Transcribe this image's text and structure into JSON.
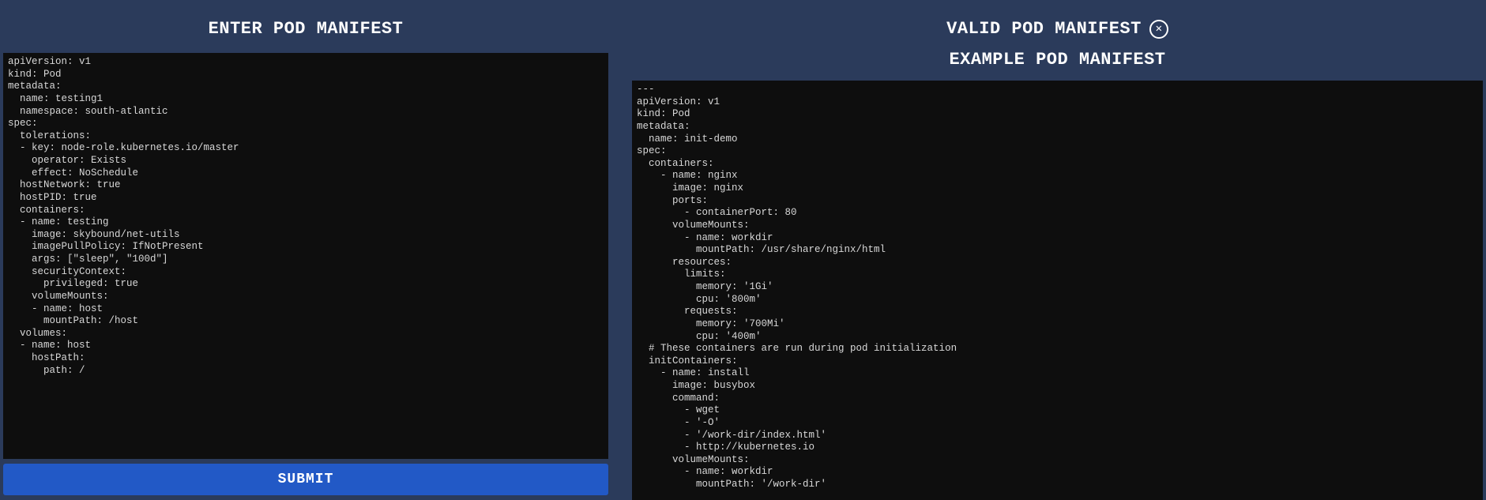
{
  "left": {
    "title": "ENTER POD MANIFEST",
    "input_value": "apiVersion: v1\nkind: Pod\nmetadata:\n  name: testing1\n  namespace: south-atlantic\nspec:\n  tolerations:\n  - key: node-role.kubernetes.io/master\n    operator: Exists\n    effect: NoSchedule\n  hostNetwork: true\n  hostPID: true\n  containers:\n  - name: testing\n    image: skybound/net-utils\n    imagePullPolicy: IfNotPresent\n    args: [\"sleep\", \"100d\"]\n    securityContext:\n      privileged: true\n    volumeMounts:\n    - name: host\n      mountPath: /host\n  volumes:\n  - name: host\n    hostPath:\n      path: /",
    "submit_label": "SUBMIT"
  },
  "right": {
    "status_text": "VALID POD MANIFEST",
    "status_icon_glyph": "✕",
    "example_title": "EXAMPLE POD MANIFEST",
    "example_value": "---\napiVersion: v1\nkind: Pod\nmetadata:\n  name: init-demo\nspec:\n  containers:\n    - name: nginx\n      image: nginx\n      ports:\n        - containerPort: 80\n      volumeMounts:\n        - name: workdir\n          mountPath: /usr/share/nginx/html\n      resources:\n        limits:\n          memory: '1Gi'\n          cpu: '800m'\n        requests:\n          memory: '700Mi'\n          cpu: '400m'\n  # These containers are run during pod initialization\n  initContainers:\n    - name: install\n      image: busybox\n      command:\n        - wget\n        - '-O'\n        - '/work-dir/index.html'\n        - http://kubernetes.io\n      volumeMounts:\n        - name: workdir\n          mountPath: '/work-dir'"
  }
}
